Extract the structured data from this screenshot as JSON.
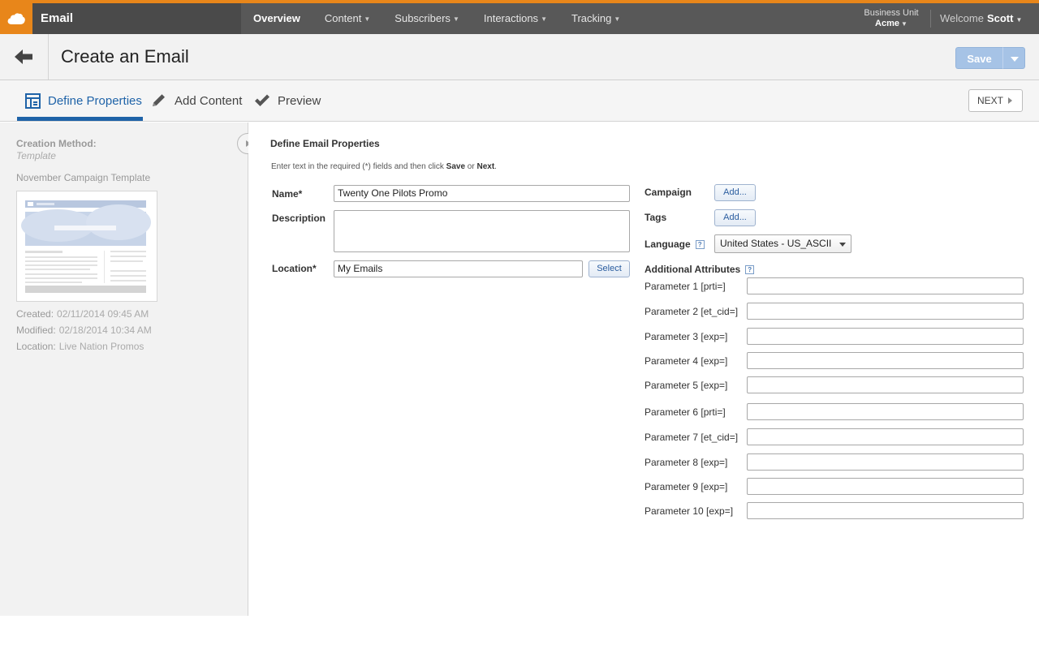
{
  "app": {
    "name": "Email"
  },
  "nav": {
    "items": [
      {
        "label": "Overview",
        "active": true,
        "has_menu": false
      },
      {
        "label": "Content",
        "active": false,
        "has_menu": true
      },
      {
        "label": "Subscribers",
        "active": false,
        "has_menu": true
      },
      {
        "label": "Interactions",
        "active": false,
        "has_menu": true
      },
      {
        "label": "Tracking",
        "active": false,
        "has_menu": true
      }
    ],
    "business_unit_label": "Business Unit",
    "business_unit_name": "Acme",
    "welcome_text": "Welcome",
    "user_name": "Scott"
  },
  "header": {
    "title": "Create an Email",
    "save_label": "Save"
  },
  "steps": [
    {
      "label": "Define Properties",
      "icon": "layout-icon",
      "active": true
    },
    {
      "label": "Add Content",
      "icon": "pencil-icon",
      "active": false
    },
    {
      "label": "Preview",
      "icon": "checkmark-icon",
      "active": false
    }
  ],
  "next_label": "NEXT",
  "left_panel": {
    "creation_method_label": "Creation Method:",
    "creation_method_value": "Template",
    "template_name": "November Campaign Template",
    "created_label": "Created:",
    "created_value": "02/11/2014 09:45 AM",
    "modified_label": "Modified:",
    "modified_value": "02/18/2014 10:34 AM",
    "location_label": "Location:",
    "location_value": "Live Nation Promos"
  },
  "form": {
    "section_title": "Define Email Properties",
    "instructions_pre": "Enter text in the required (*) fields and then click ",
    "instructions_save": "Save",
    "instructions_or": " or ",
    "instructions_next": "Next",
    "instructions_end": ".",
    "name_label": "Name*",
    "name_value": "Twenty One Pilots Promo",
    "description_label": "Description",
    "location_label": "Location*",
    "location_value": "My Emails",
    "select_label": "Select",
    "campaign_label": "Campaign",
    "campaign_add": "Add...",
    "tags_label": "Tags",
    "tags_add": "Add...",
    "language_label": "Language",
    "language_value": "United States - US_ASCII",
    "additional_label": "Additional Attributes",
    "help_glyph": "?",
    "parameters": [
      "Parameter 1 [prti=]",
      "Parameter 2 [et_cid=]",
      "Parameter 3 [exp=]",
      "Parameter 4 [exp=]",
      "Parameter 5 [exp=]",
      "Parameter 6 [prti=]",
      "Parameter 7 [et_cid=]",
      "Parameter 8 [exp=]",
      "Parameter 9 [exp=]",
      "Parameter 10  [exp=]"
    ]
  },
  "colors": {
    "brand_orange": "#e8861a",
    "accent_blue": "#1f63a8",
    "nav_bg": "#585858"
  }
}
